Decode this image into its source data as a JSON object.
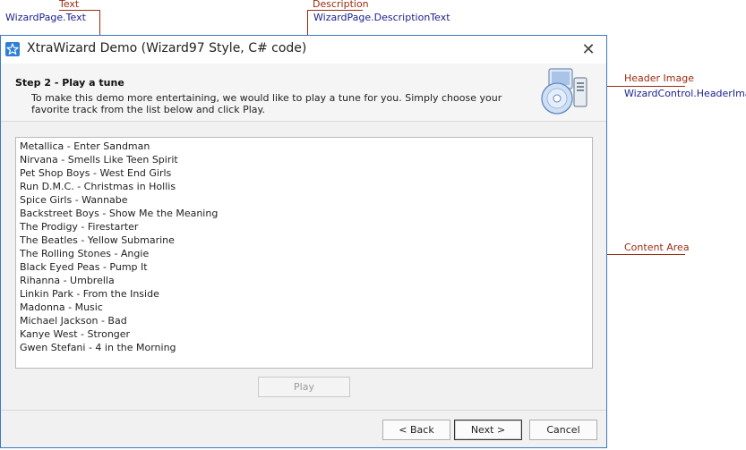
{
  "annotations": {
    "text": {
      "title": "Text",
      "property": "WizardPage.Text"
    },
    "description": {
      "title": "Description",
      "property": "WizardPage.DescriptionText"
    },
    "header_image": {
      "title": "Header Image",
      "property": "WizardControl.HeaderImage"
    },
    "content_area": {
      "title": "Content Area"
    }
  },
  "window": {
    "title": "XtraWizard Demo (Wizard97  Style, C# code)",
    "close_glyph": "✕"
  },
  "page": {
    "step_title": "Step 2 - Play a tune",
    "description": "To make this demo more entertaining, we would like to play a tune for you. Simply choose your favorite track from the list below and click Play."
  },
  "tracks": [
    "Metallica - Enter Sandman",
    "Nirvana - Smells Like Teen Spirit",
    "Pet Shop Boys - West End Girls",
    "Run D.M.C. - Christmas in Hollis",
    "Spice Girls - Wannabe",
    "Backstreet Boys - Show Me the Meaning",
    "The Prodigy - Firestarter",
    "The Beatles - Yellow Submarine",
    "The Rolling Stones - Angie",
    "Black Eyed Peas - Pump It",
    "Rihanna - Umbrella",
    "Linkin Park - From the Inside",
    "Madonna - Music",
    "Michael Jackson - Bad",
    "Kanye West - Stronger",
    "Gwen Stefani - 4 in the Morning"
  ],
  "buttons": {
    "play": "Play",
    "back": "< Back",
    "next": "Next >",
    "cancel": "Cancel"
  },
  "icons": {
    "app": "wizard-star-icon",
    "header": "computer-cd-icon"
  },
  "colors": {
    "annotation": "#9a2c12",
    "property": "#1a1f8c",
    "window_border": "#3c78c8"
  }
}
